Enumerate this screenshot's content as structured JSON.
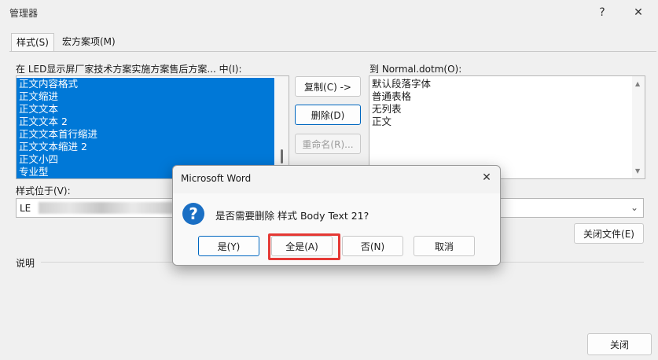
{
  "window": {
    "title": "管理器",
    "help_label": "?",
    "close_label": "✕"
  },
  "tabs": [
    {
      "label": "样式(S)",
      "active": true
    },
    {
      "label": "宏方案项(M)",
      "active": false
    }
  ],
  "left_panel": {
    "label": "在 LED显示屏厂家技术方案实施方案售后方案... 中(I):",
    "items": [
      "正文内容格式",
      "正文缩进",
      "正文文本",
      "正文文本 2",
      "正文文本首行缩进",
      "正文文本缩进 2",
      "正文小四",
      "专业型"
    ],
    "location_label": "样式位于(V):",
    "location_value": "LE"
  },
  "right_panel": {
    "label": "到 Normal.dotm(O):",
    "items": [
      "默认段落字体",
      "普通表格",
      "无列表",
      "正文"
    ],
    "close_file_button": "关闭文件(E)"
  },
  "buttons": {
    "copy": "复制(C) ->",
    "delete": "删除(D)",
    "rename": "重命名(R)...",
    "close": "关闭"
  },
  "description_label": "说明",
  "dialog": {
    "title": "Microsoft Word",
    "close_label": "✕",
    "icon_glyph": "?",
    "message": "是否需要删除 样式 Body Text 21?",
    "buttons": {
      "yes": "是(Y)",
      "yes_all": "全是(A)",
      "no": "否(N)",
      "cancel": "取消"
    }
  },
  "colors": {
    "selection": "#0078d7",
    "highlight": "#e53935",
    "dialog_icon": "#1a6fc4"
  }
}
